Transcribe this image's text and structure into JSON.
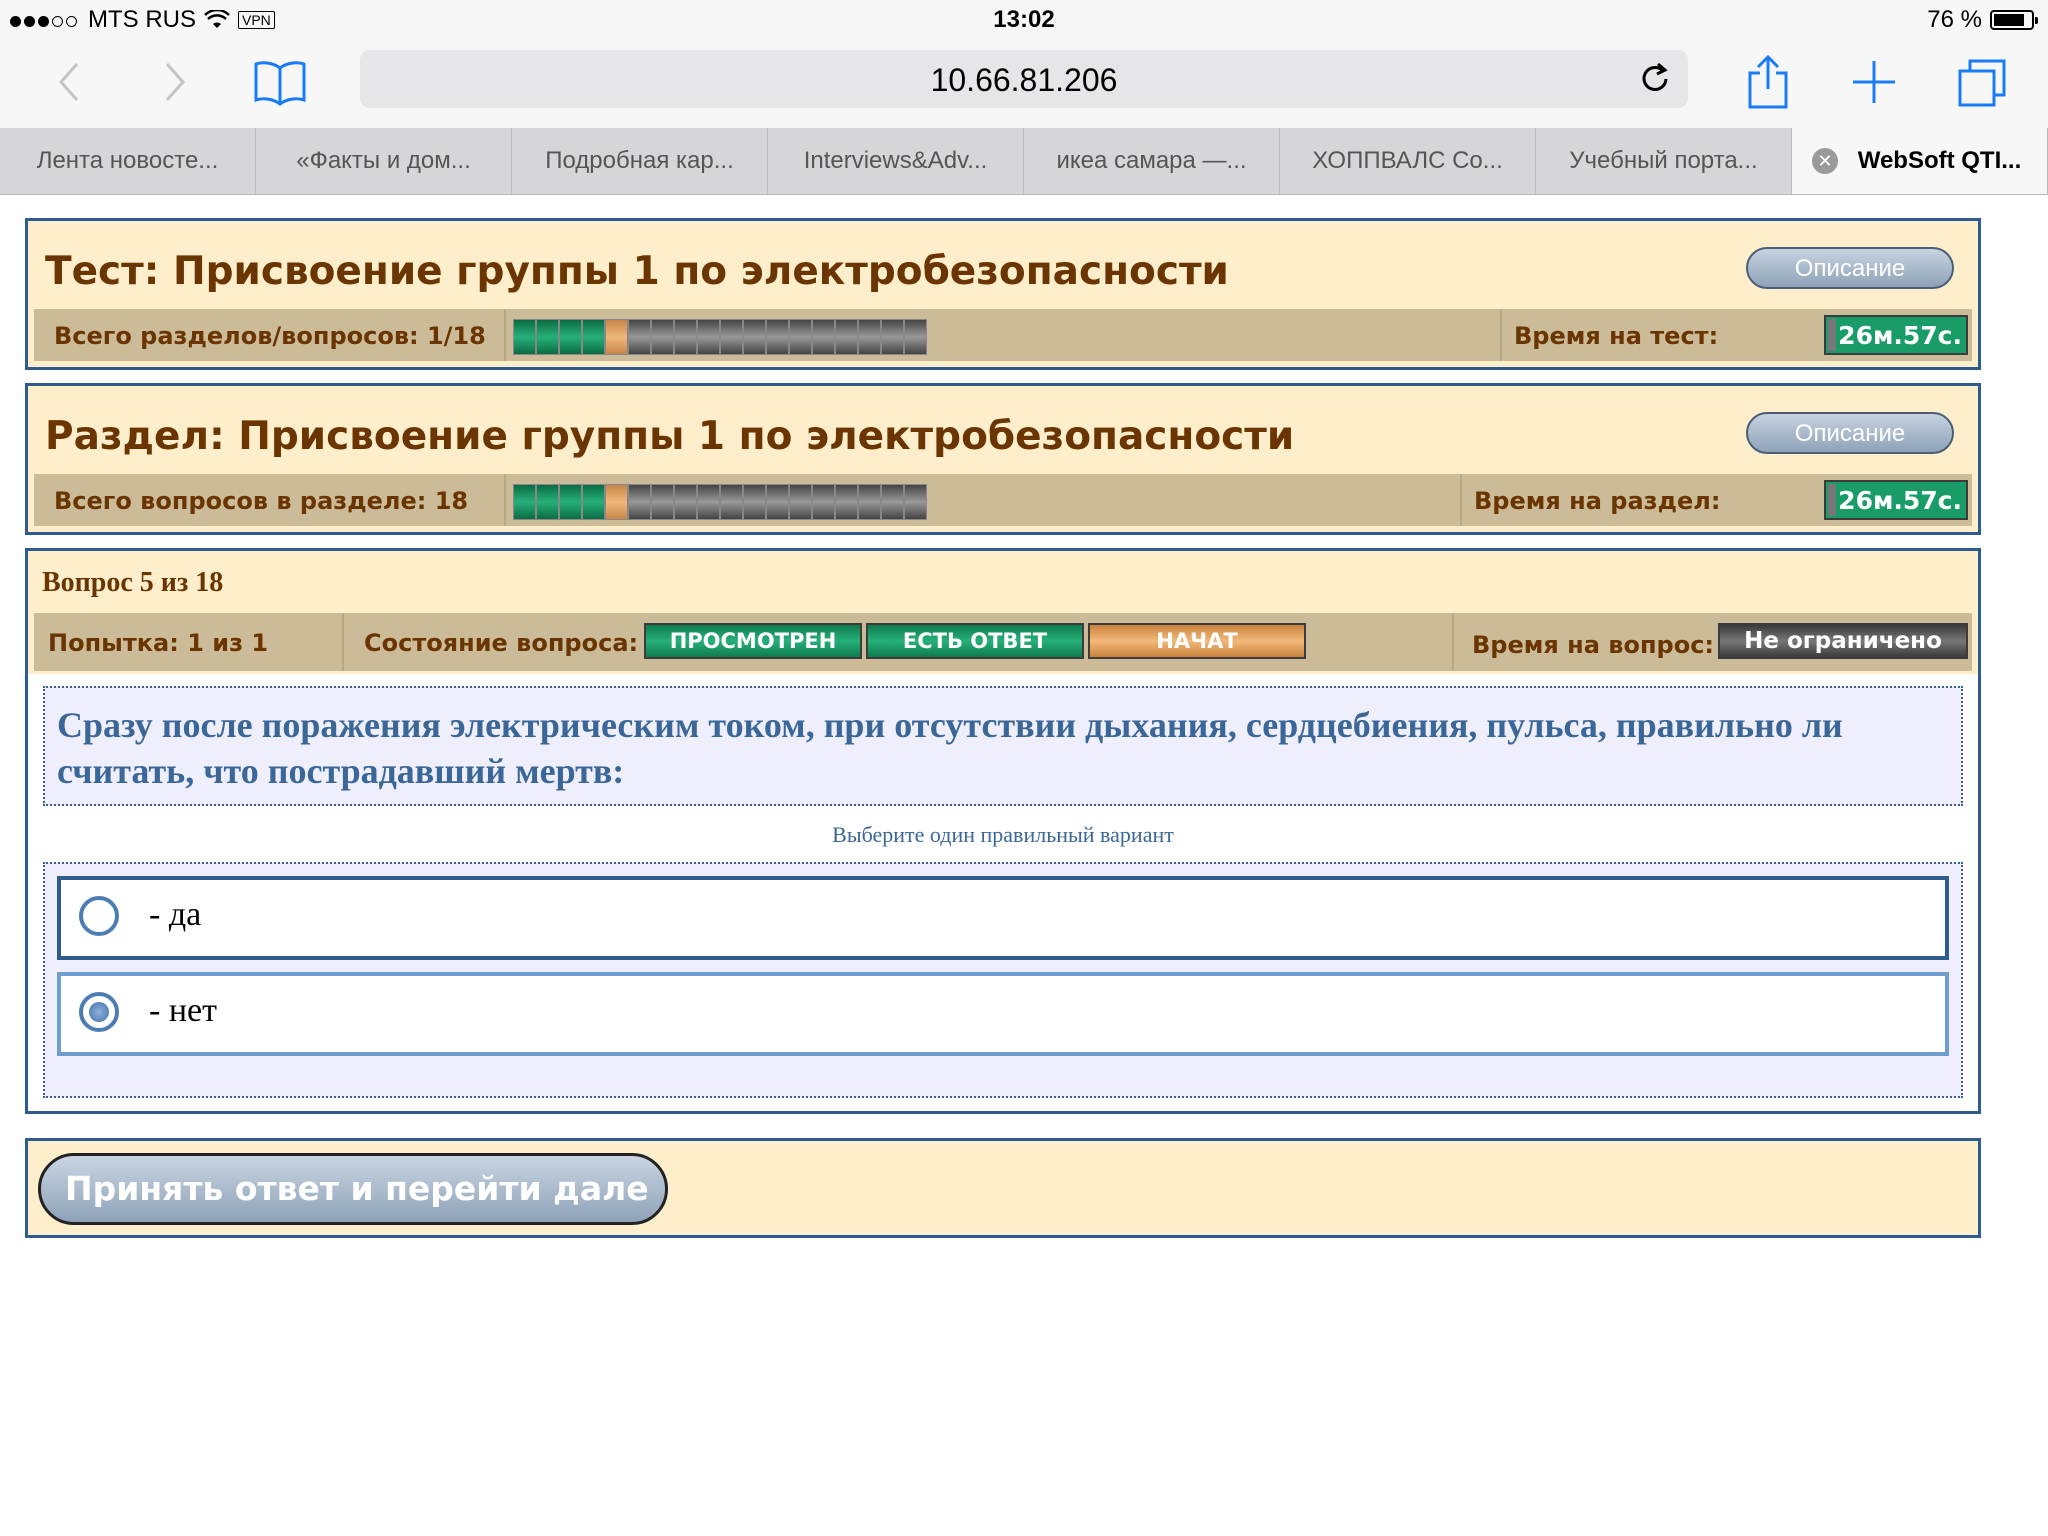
{
  "status_bar": {
    "carrier": "MTS RUS",
    "vpn": "VPN",
    "time": "13:02",
    "battery": "76 %"
  },
  "browser": {
    "url": "10.66.81.206",
    "tabs": [
      {
        "label": "Лента новосте..."
      },
      {
        "label": "«Факты и дом..."
      },
      {
        "label": "Подробная кар..."
      },
      {
        "label": "Interviews&Adv..."
      },
      {
        "label": "икеа самара —..."
      },
      {
        "label": "ХОППВАЛС Co..."
      },
      {
        "label": "Учебный порта..."
      },
      {
        "label": "WebSoft QTI..."
      }
    ],
    "active_tab_index": 7
  },
  "test_panel": {
    "title": "Тест: Присвоение группы 1 по электробезопасности",
    "description_label": "Описание",
    "progress_label": "Всего разделов/вопросов: 1/18",
    "progress_total": 18,
    "progress_done": 4,
    "progress_current": 5,
    "time_label": "Время на тест:",
    "timer": "26м.57с."
  },
  "section_panel": {
    "title": "Раздел: Присвоение группы 1 по электробезопасности",
    "description_label": "Описание",
    "progress_label": "Всего вопросов в разделе: 18",
    "progress_total": 18,
    "progress_done": 4,
    "progress_current": 5,
    "time_label": "Время на раздел:",
    "timer": "26м.57с."
  },
  "question_panel": {
    "heading": "Вопрос 5 из 18",
    "attempt": "Попытка: 1 из 1",
    "state_label": "Состояние вопроса:",
    "states": [
      "ПРОСМОТРЕН",
      "ЕСТЬ ОТВЕТ",
      "НАЧАТ"
    ],
    "time_label": "Время на вопрос:",
    "time_value": "Не ограничено",
    "text": "Сразу после поражения электрическим током, при отсутствии дыхания, сердцебиения, пульса, правильно ли считать, что пострадавший мертв:",
    "hint": "Выберите один правильный вариант",
    "answers": [
      {
        "label": "- да",
        "selected": false
      },
      {
        "label": "- нет",
        "selected": true
      }
    ]
  },
  "footer": {
    "accept_label": "Принять ответ и перейти дале"
  },
  "colors": {
    "panel_bg": "#ffeecb",
    "panel_border": "#2e5c8e",
    "strip_bg": "#ccbb99",
    "title_brown": "#6a3500",
    "question_blue": "#3a6797",
    "green": "#1a9c68",
    "orange": "#f0b77a"
  }
}
